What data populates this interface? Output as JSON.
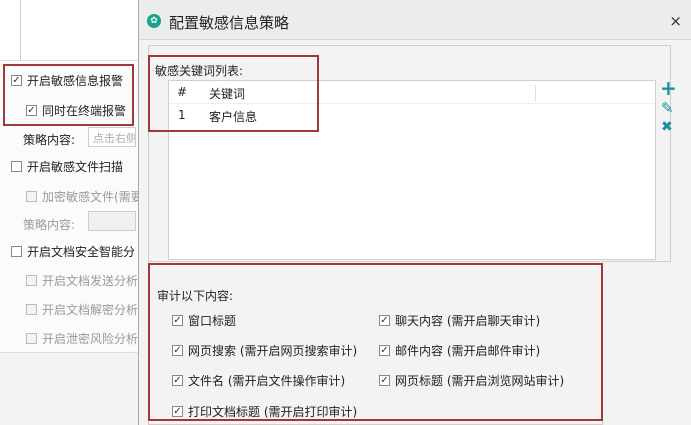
{
  "left_panel": {
    "enable_sensitive_alert": "开启敏感信息报警",
    "terminal_alert": "同时在终端报警",
    "policy_label_1": "策略内容:",
    "policy_placeholder_1": "点击右侧",
    "enable_file_scan": "开启敏感文件扫描",
    "encrypt_sensitive": "加密敏感文件(需要",
    "policy_label_2": "策略内容:",
    "enable_doc_ai": "开启文档安全智能分",
    "doc_send": "开启文档发送分析",
    "doc_decrypt": "开启文档解密分析",
    "leak_risk": "开启泄密风险分析"
  },
  "dialog": {
    "title": "配置敏感信息策略",
    "close": "×",
    "keyword_list_label": "敏感关键词列表:",
    "table": {
      "headers": [
        "#",
        "关键词"
      ],
      "rows": [
        {
          "num": "1",
          "keyword": "客户信息"
        }
      ]
    },
    "actions": {
      "add": "+",
      "edit": "✎",
      "delete": "✖"
    },
    "audit_label": "审计以下内容:",
    "audit_items": [
      "窗口标题",
      "聊天内容 (需开启聊天审计)",
      "网页搜索 (需开启网页搜索审计)",
      "邮件内容 (需开启邮件审计)",
      "文件名 (需开启文件操作审计)",
      "网页标题 (需开启浏览网站审计)",
      "打印文档标题 (需开启打印审计)"
    ]
  },
  "colors": {
    "annotation_red": "#a0383a",
    "accent_green": "#17a389",
    "action_blue": "#1a8fa0"
  }
}
